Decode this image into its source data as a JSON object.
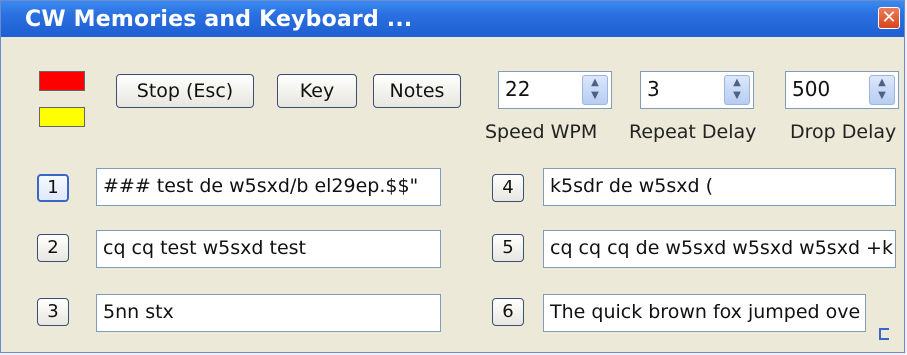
{
  "window": {
    "title": "CW Memories and Keyboard ...",
    "close_glyph": "✕"
  },
  "indicators": {
    "top_color": "#ff0000",
    "bottom_color": "#ffff00"
  },
  "toolbar": {
    "stop_label": "Stop (Esc)",
    "key_label": "Key",
    "notes_label": "Notes"
  },
  "settings": {
    "speed": {
      "value": "22",
      "label": "Speed WPM"
    },
    "repeat": {
      "value": "3",
      "label": "Repeat Delay"
    },
    "drop": {
      "value": "500",
      "label": "Drop Delay"
    }
  },
  "memories": [
    {
      "number": "1",
      "text": "### test de w5sxd/b el29ep.$$\""
    },
    {
      "number": "2",
      "text": "cq cq test w5sxd test"
    },
    {
      "number": "3",
      "text": "5nn stx"
    },
    {
      "number": "4",
      "text": "k5sdr de w5sxd ("
    },
    {
      "number": "5",
      "text": "cq cq cq de w5sxd w5sxd w5sxd +k"
    },
    {
      "number": "6",
      "text": "The quick brown fox jumped ove"
    }
  ],
  "icons": {
    "close": "close-icon",
    "spin": "spin-arrows-icon",
    "grip": "resize-grip-icon"
  }
}
